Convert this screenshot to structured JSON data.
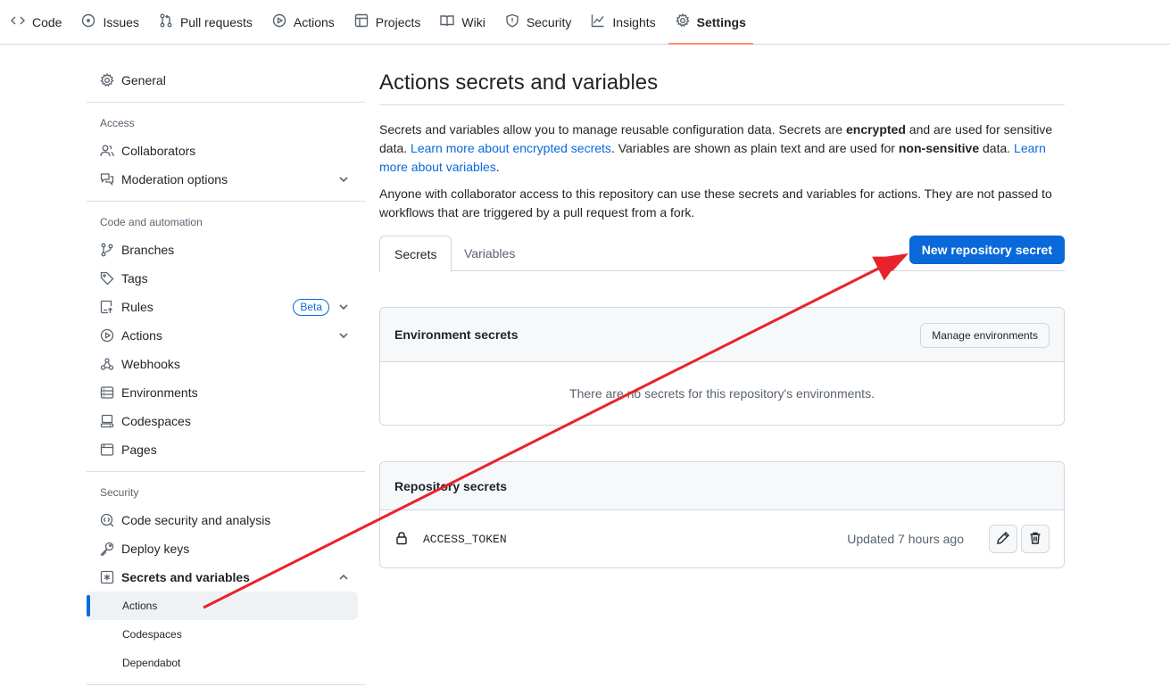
{
  "topnav": {
    "tabs": [
      {
        "label": "Code",
        "icon": "code-icon"
      },
      {
        "label": "Issues",
        "icon": "issue-opened-icon"
      },
      {
        "label": "Pull requests",
        "icon": "git-pull-request-icon"
      },
      {
        "label": "Actions",
        "icon": "play-icon"
      },
      {
        "label": "Projects",
        "icon": "table-icon"
      },
      {
        "label": "Wiki",
        "icon": "book-icon"
      },
      {
        "label": "Security",
        "icon": "shield-icon"
      },
      {
        "label": "Insights",
        "icon": "graph-icon"
      },
      {
        "label": "Settings",
        "icon": "gear-icon",
        "active": true
      }
    ]
  },
  "sidebar": {
    "general": "General",
    "access_heading": "Access",
    "collaborators": "Collaborators",
    "moderation": "Moderation options",
    "code_automation_heading": "Code and automation",
    "branches": "Branches",
    "tags": "Tags",
    "rules": "Rules",
    "rules_badge": "Beta",
    "actions": "Actions",
    "webhooks": "Webhooks",
    "environments": "Environments",
    "codespaces": "Codespaces",
    "pages": "Pages",
    "security_heading": "Security",
    "code_security": "Code security and analysis",
    "deploy_keys": "Deploy keys",
    "secrets_variables": "Secrets and variables",
    "sub_actions": "Actions",
    "sub_codespaces": "Codespaces",
    "sub_dependabot": "Dependabot"
  },
  "main": {
    "title": "Actions secrets and variables",
    "desc1_a": "Secrets and variables allow you to manage reusable configuration data. Secrets are ",
    "desc1_b": "encrypted",
    "desc1_c": " and are used for sensitive data. ",
    "desc1_link1": "Learn more about encrypted secrets",
    "desc1_d": ". Variables are shown as plain text and are used for ",
    "desc1_e": "non-sensitive",
    "desc1_f": " data. ",
    "desc1_link2": "Learn more about variables",
    "desc1_g": ".",
    "desc2": "Anyone with collaborator access to this repository can use these secrets and variables for actions. They are not passed to workflows that are triggered by a pull request from a fork.",
    "tab_secrets": "Secrets",
    "tab_variables": "Variables",
    "new_secret_button": "New repository secret",
    "env_secrets_heading": "Environment secrets",
    "manage_env_button": "Manage environments",
    "env_empty": "There are no secrets for this repository's environments.",
    "repo_secrets_heading": "Repository secrets",
    "secrets": [
      {
        "name": "ACCESS_TOKEN",
        "updated": "Updated 7 hours ago"
      }
    ]
  },
  "colors": {
    "accent": "#0969da",
    "active_tab_underline": "#fd8c73",
    "annotation_arrow": "#e8232b"
  }
}
